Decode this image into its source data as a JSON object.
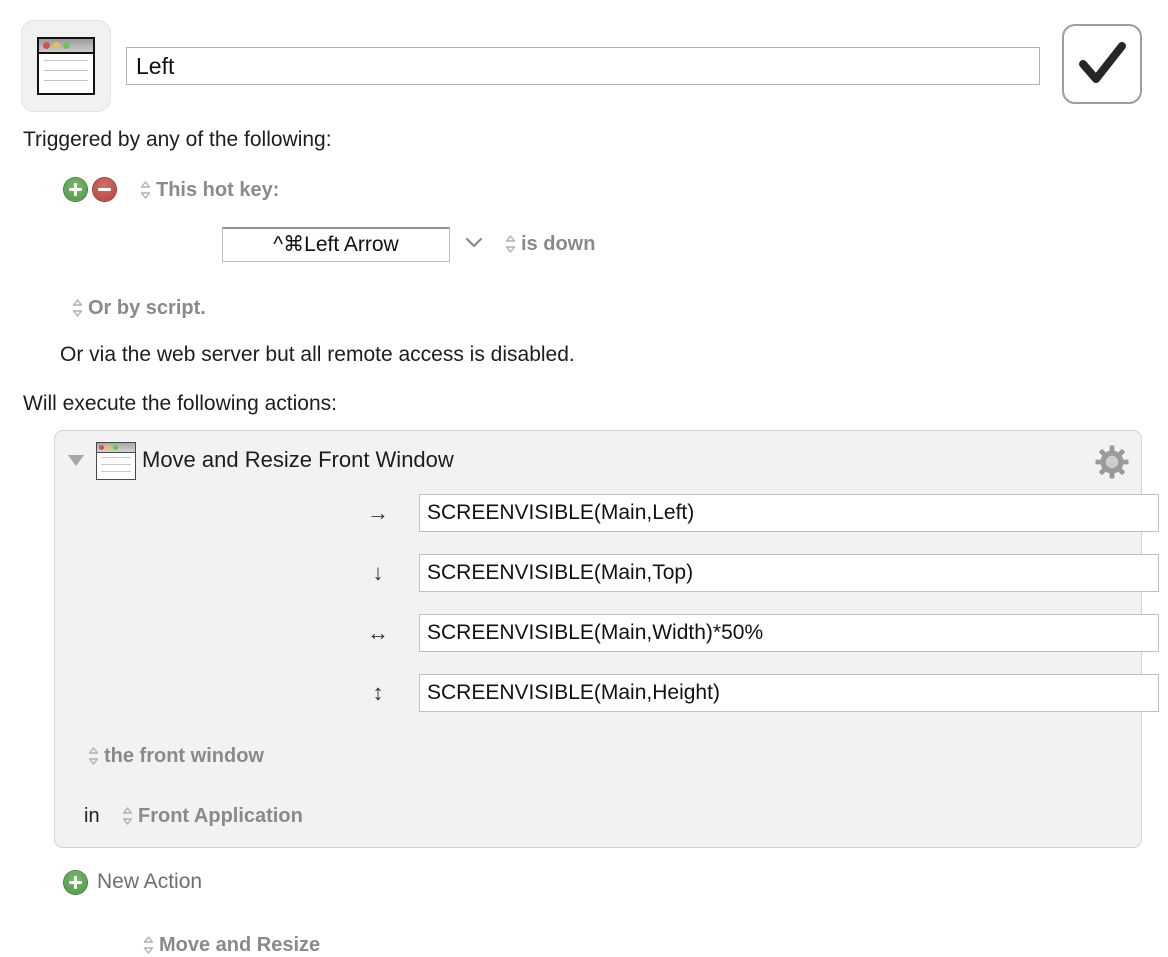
{
  "macro": {
    "icon_name": "window-macro-icon",
    "name_value": "Left",
    "name_placeholder": "Macro Name",
    "confirm_icon": "checkmark-icon"
  },
  "trigger": {
    "heading": "Triggered by any of the following:",
    "add_button_icon": "plus-circle-icon",
    "remove_button_icon": "minus-circle-icon",
    "type_label": "This hot key:",
    "hotkey_value": "^⌘Left Arrow",
    "hotkey_chevron_icon": "chevron-down-icon",
    "condition_label": "is down",
    "script_label": "Or by script.",
    "web_note": "Or via the web server but all remote access is disabled."
  },
  "actions": {
    "heading": "Will execute the following actions:",
    "panel": {
      "disclosure_icon": "disclosure-triangle-open-icon",
      "icon_name": "window-action-icon",
      "title": "Move and Resize Front Window",
      "gear_icon": "gear-icon",
      "operation_label": "Move and Resize",
      "params": [
        {
          "arrow": "→",
          "arrow_name": "arrow-right-icon",
          "value": "SCREENVISIBLE(Main,Left)",
          "field_name": "x-position-field"
        },
        {
          "arrow": "↓",
          "arrow_name": "arrow-down-icon",
          "value": "SCREENVISIBLE(Main,Top)",
          "field_name": "y-position-field"
        },
        {
          "arrow": "↔",
          "arrow_name": "arrow-left-right-icon",
          "value": "SCREENVISIBLE(Main,Width)*50%",
          "field_name": "width-field"
        },
        {
          "arrow": "↕",
          "arrow_name": "arrow-up-down-icon",
          "value": "SCREENVISIBLE(Main,Height)",
          "field_name": "height-field"
        }
      ],
      "target_label": "the front window",
      "in_word": "in",
      "application_label": "Front Application"
    },
    "new_action_label": "New Action",
    "new_action_icon": "plus-circle-icon"
  },
  "colors": {
    "add_green": "#4f9549",
    "remove_red": "#b3403f",
    "panel_background": "#f2f2f2",
    "gray_label": "#8a8a8a"
  }
}
